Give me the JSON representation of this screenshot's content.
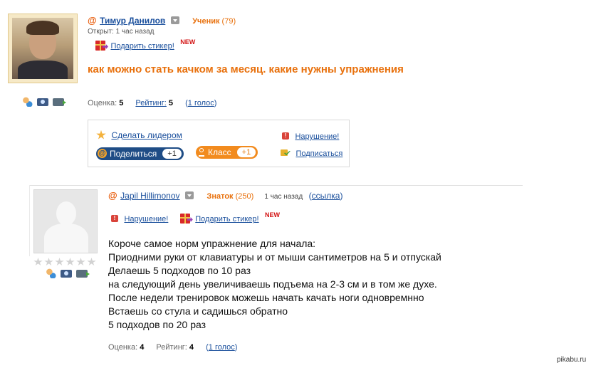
{
  "question": {
    "author_name": "Тимур Данилов",
    "author_rank": "Ученик",
    "author_points": "(79)",
    "opened": "Открыт: 1 час назад",
    "sticker_link": "Подарить стикер!",
    "new_badge": "NEW",
    "title": "как можно стать качком за месяц. какие нужны упражнения",
    "score_label": "Оценка:",
    "score_value": "5",
    "rating_label": "Рейтинг:",
    "rating_value": "5",
    "votes_open": "(",
    "votes_link": "1 голос",
    "votes_close": ")"
  },
  "actions": {
    "make_leader": "Сделать лидером",
    "violation": "Нарушение!",
    "share_label": "Поделиться",
    "share_count": "+1",
    "class_label": "Класс",
    "class_count": "+1",
    "subscribe": "Подписаться"
  },
  "answer": {
    "author_name": "Japil Hillimonov",
    "author_rank": "Знаток",
    "author_points": "(250)",
    "time": "1 час назад",
    "link_open": "(",
    "link_text": "ссылка",
    "link_close": ")",
    "violation": "Нарушение!",
    "sticker_link": "Подарить стикер!",
    "new_badge": "NEW",
    "lines": [
      "Короче самое норм упражнение для начала:",
      "Приодними руки от клавиатуры и от мыши сантиметров на 5 и отпускай",
      "Делаешь 5 подходов по 10 раз",
      "на следующий день увеличиваешь подъема на 2-3 см и в том же духе.",
      "После недели тренировок можешь начать качать ноги одновремнно",
      "Встаешь со стула и садишься обратно",
      "5 подходов по 20 раз"
    ],
    "score_label": "Оценка:",
    "score_value": "4",
    "rating_label": "Рейтинг:",
    "rating_value": "4",
    "votes_open": "(",
    "votes_link": "1 голос",
    "votes_close": ")"
  },
  "watermark": "pikabu.ru",
  "icons": {
    "at": "@",
    "warning": "!"
  },
  "colors": {
    "accent_orange": "#e8700c",
    "link_blue": "#1a4f9c",
    "share_blue": "#1f4d86",
    "class_orange": "#f28b1e",
    "new_red": "#d31414"
  }
}
